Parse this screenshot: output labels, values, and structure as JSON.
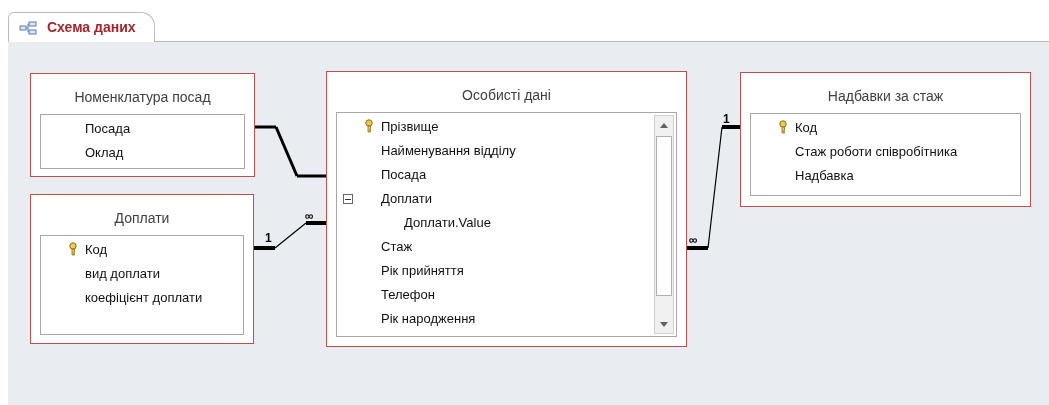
{
  "tab": {
    "label": "Схема даних",
    "selected": true
  },
  "tables": [
    {
      "title": "Номенклатура посад",
      "scrollable": false,
      "fields": [
        {
          "name": "Посада",
          "key": false
        },
        {
          "name": "Оклад",
          "key": false
        }
      ]
    },
    {
      "title": "Доплати",
      "scrollable": false,
      "fields": [
        {
          "name": "Код",
          "key": true
        },
        {
          "name": "вид доплати",
          "key": false
        },
        {
          "name": "коефіцієнт доплати",
          "key": false
        }
      ]
    },
    {
      "title": "Особисті дані",
      "scrollable": true,
      "fields": [
        {
          "name": "Прізвище",
          "key": true
        },
        {
          "name": "Найменування відділу",
          "key": false
        },
        {
          "name": "Посада",
          "key": false
        },
        {
          "name": "Доплати",
          "key": false,
          "expanded": true,
          "children": [
            {
              "name": "Доплати.Value",
              "key": false
            }
          ]
        },
        {
          "name": "Стаж",
          "key": false
        },
        {
          "name": "Рік прийняття",
          "key": false
        },
        {
          "name": "Телефон",
          "key": false
        },
        {
          "name": "Рік народження",
          "key": false
        }
      ]
    },
    {
      "title": "Надбавки за стаж",
      "scrollable": false,
      "fields": [
        {
          "name": "Код",
          "key": true
        },
        {
          "name": "Стаж роботи співробітника",
          "key": false
        },
        {
          "name": "Надбавка",
          "key": false
        }
      ]
    }
  ],
  "relationships": [
    {
      "kind": "plain"
    },
    {
      "kind": "enforced",
      "one_label": "1",
      "many_label": "∞"
    },
    {
      "kind": "enforced",
      "one_label": "1",
      "many_label": "∞"
    }
  ]
}
